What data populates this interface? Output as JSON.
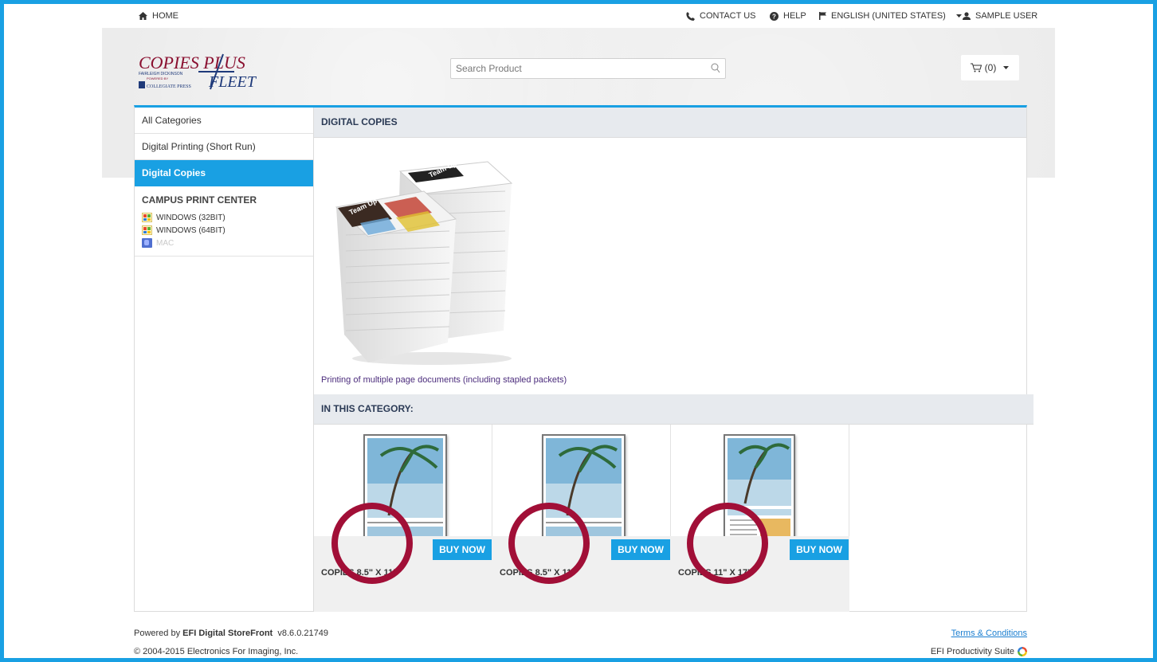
{
  "topnav": {
    "home": "HOME",
    "contact": "CONTACT US",
    "help": "HELP",
    "language": "ENGLISH (UNITED STATES)",
    "user": "SAMPLE USER"
  },
  "header": {
    "logo": {
      "line1": "COPIES PLUS",
      "line2": "FLEET",
      "sub1": "FAIRLEIGH DICKINSON",
      "sub2": "POWERED BY",
      "sub3": "COLLEGIATE PRESS"
    },
    "search_placeholder": "Search Product",
    "cart_label": "(0)"
  },
  "sidebar": {
    "items": [
      {
        "label": "All Categories"
      },
      {
        "label": "Digital Printing (Short Run)"
      },
      {
        "label": "Digital Copies"
      }
    ],
    "group_title": "CAMPUS PRINT CENTER",
    "os": [
      {
        "label": "WINDOWS (32BIT)"
      },
      {
        "label": "WINDOWS (64BIT)"
      },
      {
        "label": "MAC"
      }
    ]
  },
  "content": {
    "title": "DIGITAL COPIES",
    "description": "Printing of multiple page documents (including stapled packets)",
    "category_title": "IN THIS CATEGORY:",
    "buy_label": "BUY NOW",
    "products": [
      {
        "name": "COPIES 8.5\" X 11\""
      },
      {
        "name": "COPIES 8.5\" X 11\""
      },
      {
        "name": "COPIES 11\" X 17\""
      }
    ]
  },
  "footer": {
    "powered_prefix": "Powered by ",
    "powered_brand": "EFI Digital StoreFront",
    "version": "v8.6.0.21749",
    "copyright": "© 2004-2015 Electronics For Imaging, Inc.",
    "terms": "Terms & Conditions",
    "suite": "EFI Productivity Suite"
  },
  "colors": {
    "accent": "#19a0e3",
    "annotation_circle": "#a10f37",
    "section_head": "#e7eaee"
  }
}
